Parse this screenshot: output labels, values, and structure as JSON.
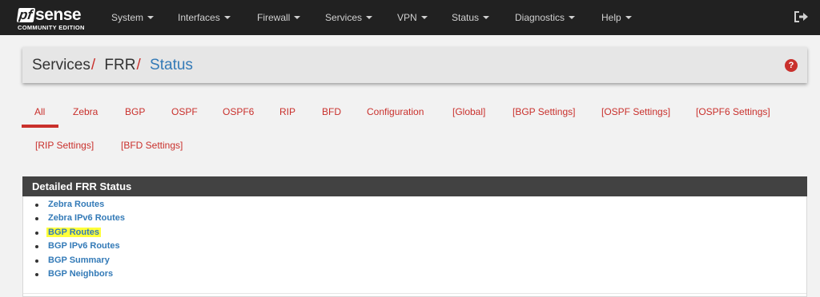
{
  "logo": {
    "brand_pf": "pf",
    "brand_sense": "sense",
    "edition": "COMMUNITY EDITION"
  },
  "navbar": {
    "items": [
      {
        "label": "System"
      },
      {
        "label": "Interfaces"
      },
      {
        "label": "Firewall"
      },
      {
        "label": "Services"
      },
      {
        "label": "VPN"
      },
      {
        "label": "Status"
      },
      {
        "label": "Diagnostics"
      },
      {
        "label": "Help"
      }
    ],
    "logout_icon": "sign-out-icon"
  },
  "breadcrumb": {
    "items": [
      "Services",
      "FRR",
      "Status"
    ],
    "separator": "/"
  },
  "help_icon": {
    "glyph": "?",
    "icon": "question-circle-icon",
    "color": "#c9302c"
  },
  "tabs": [
    {
      "label": "All",
      "active": true
    },
    {
      "label": "Zebra"
    },
    {
      "label": "BGP"
    },
    {
      "label": "OSPF"
    },
    {
      "label": "OSPF6"
    },
    {
      "label": "RIP"
    },
    {
      "label": "BFD"
    },
    {
      "label": "Configuration"
    },
    {
      "label": "[Global]"
    },
    {
      "label": "[BGP Settings]"
    },
    {
      "label": "[OSPF Settings]"
    },
    {
      "label": "[OSPF6 Settings]"
    },
    {
      "label": "[RIP Settings]"
    },
    {
      "label": "[BFD Settings]"
    }
  ],
  "status_panel": {
    "title": "Detailed FRR Status",
    "links": [
      {
        "label": "Zebra Routes"
      },
      {
        "label": "Zebra IPv6 Routes"
      },
      {
        "label": "BGP Routes",
        "highlighted": true
      },
      {
        "label": "BGP IPv6 Routes"
      },
      {
        "label": "BGP Summary"
      },
      {
        "label": "BGP Neighbors"
      }
    ]
  },
  "colors": {
    "navbar_bg": "#212121",
    "accent_red": "#c9302c",
    "link_blue": "#337ab7",
    "panel_heading_bg": "#424242",
    "highlight": "#ffff3a"
  }
}
